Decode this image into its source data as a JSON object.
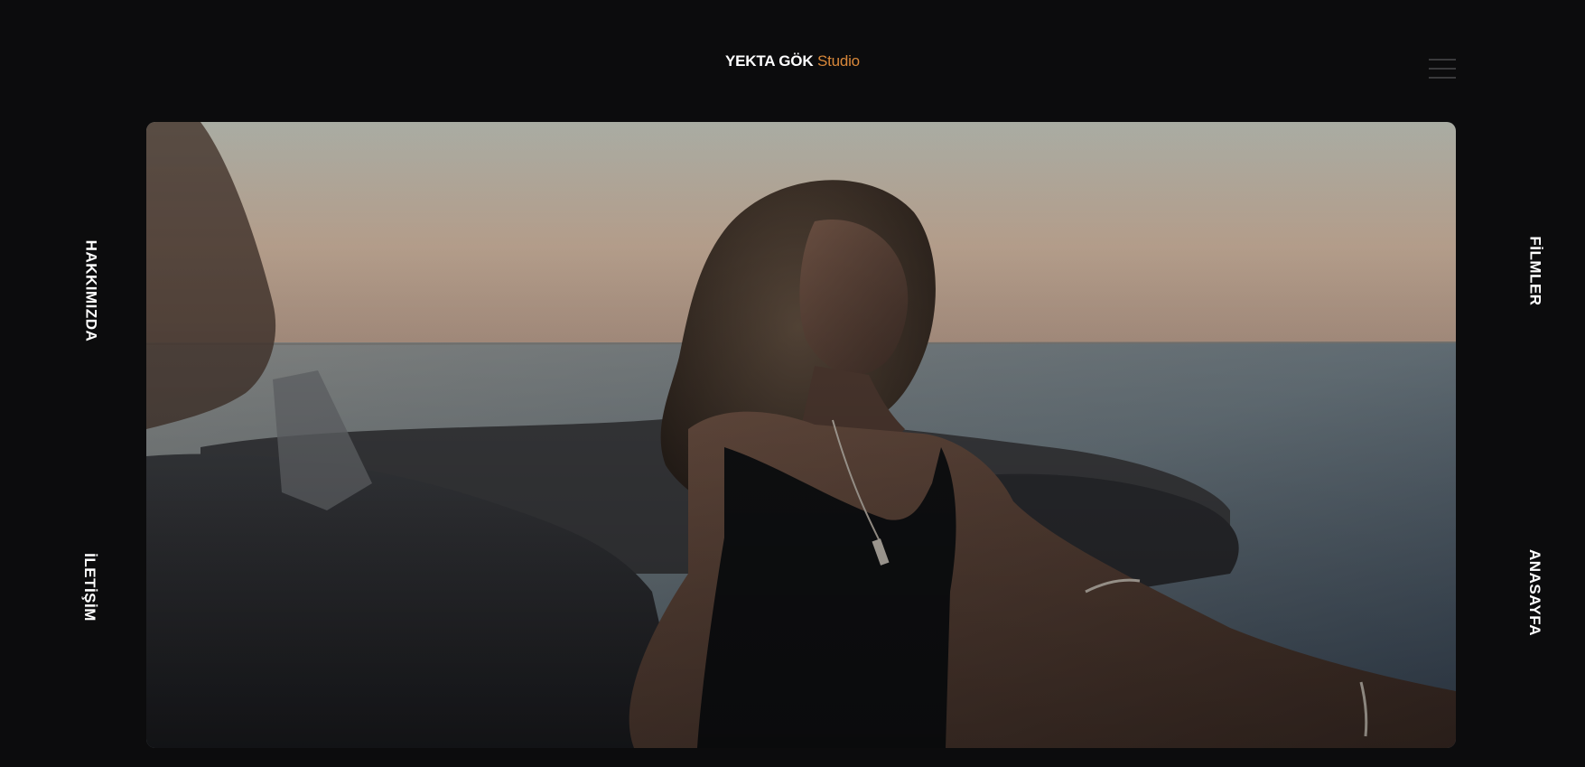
{
  "header": {
    "brand": "YEKTA GÖK",
    "brand_accent": "Studio",
    "accent_color": "#d9883a"
  },
  "menu": {
    "icon": "hamburger-menu-icon"
  },
  "side_nav": {
    "left": [
      {
        "label": "HAKKIMIZDA"
      },
      {
        "label": "İLETİŞİM"
      }
    ],
    "right": [
      {
        "label": "FİLMLER"
      },
      {
        "label": "ANASAYFA"
      }
    ]
  },
  "hero": {
    "description": "Showreel still: woman on seaside rocks at dusk"
  }
}
